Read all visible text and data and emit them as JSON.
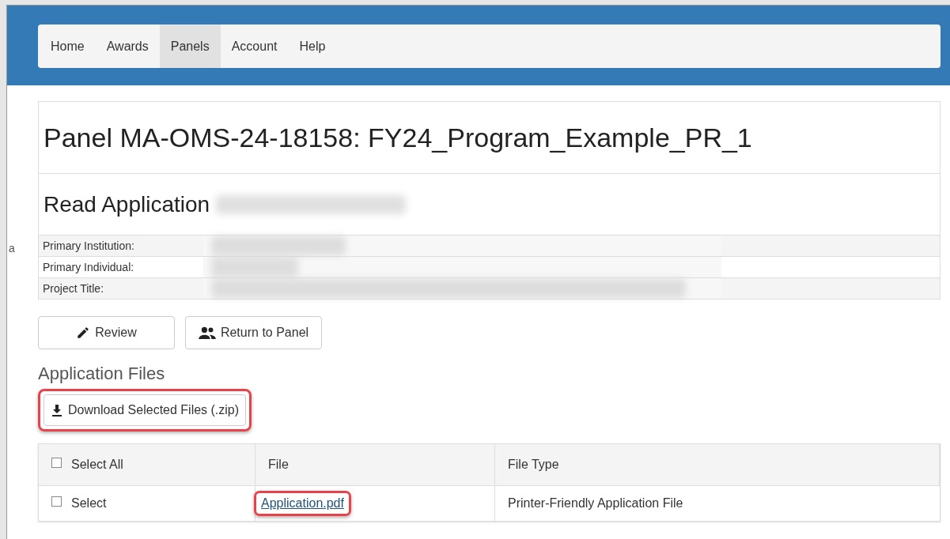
{
  "edge_text": "a",
  "nav": [
    {
      "label": "Home",
      "selected": false
    },
    {
      "label": "Awards",
      "selected": false
    },
    {
      "label": "Panels",
      "selected": true
    },
    {
      "label": "Account",
      "selected": false
    },
    {
      "label": "Help",
      "selected": false
    }
  ],
  "panel_title": "Panel MA-OMS-24-18158: FY24_Program_Example_PR_1",
  "read_heading": "Read Application",
  "info_rows": [
    {
      "label": "Primary Institution:"
    },
    {
      "label": "Primary Individual:"
    },
    {
      "label": "Project Title:"
    }
  ],
  "buttons": [
    {
      "kind": "edit",
      "label": "Review"
    },
    {
      "kind": "people",
      "label": "Return to Panel"
    }
  ],
  "files_heading": "Application Files",
  "download_button": {
    "label": "Download Selected Files (.zip)",
    "highlighted": true
  },
  "table": {
    "columns": [
      {
        "kind": "select",
        "label": "Select All",
        "checked": false
      },
      {
        "kind": "text",
        "label": "File"
      },
      {
        "kind": "text",
        "label": "File Type"
      }
    ],
    "rows": [
      {
        "select_label": "Select",
        "checked": false,
        "file": "Application.pdf",
        "file_highlighted": true,
        "file_type": "Printer-Friendly Application File"
      }
    ]
  }
}
